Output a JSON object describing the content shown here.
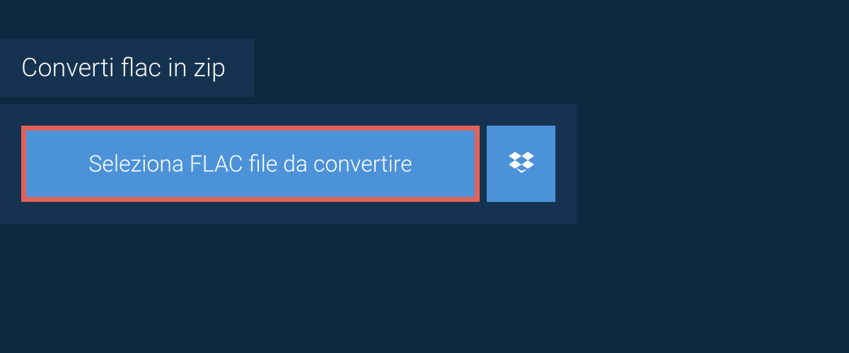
{
  "tab": {
    "title": "Converti flac in zip"
  },
  "panel": {
    "select_button_label": "Seleziona FLAC file da convertire"
  },
  "colors": {
    "background": "#0d2840",
    "panel": "#153350",
    "button": "#4c92d9",
    "highlight_border": "#e26258",
    "text": "#ffffff"
  }
}
